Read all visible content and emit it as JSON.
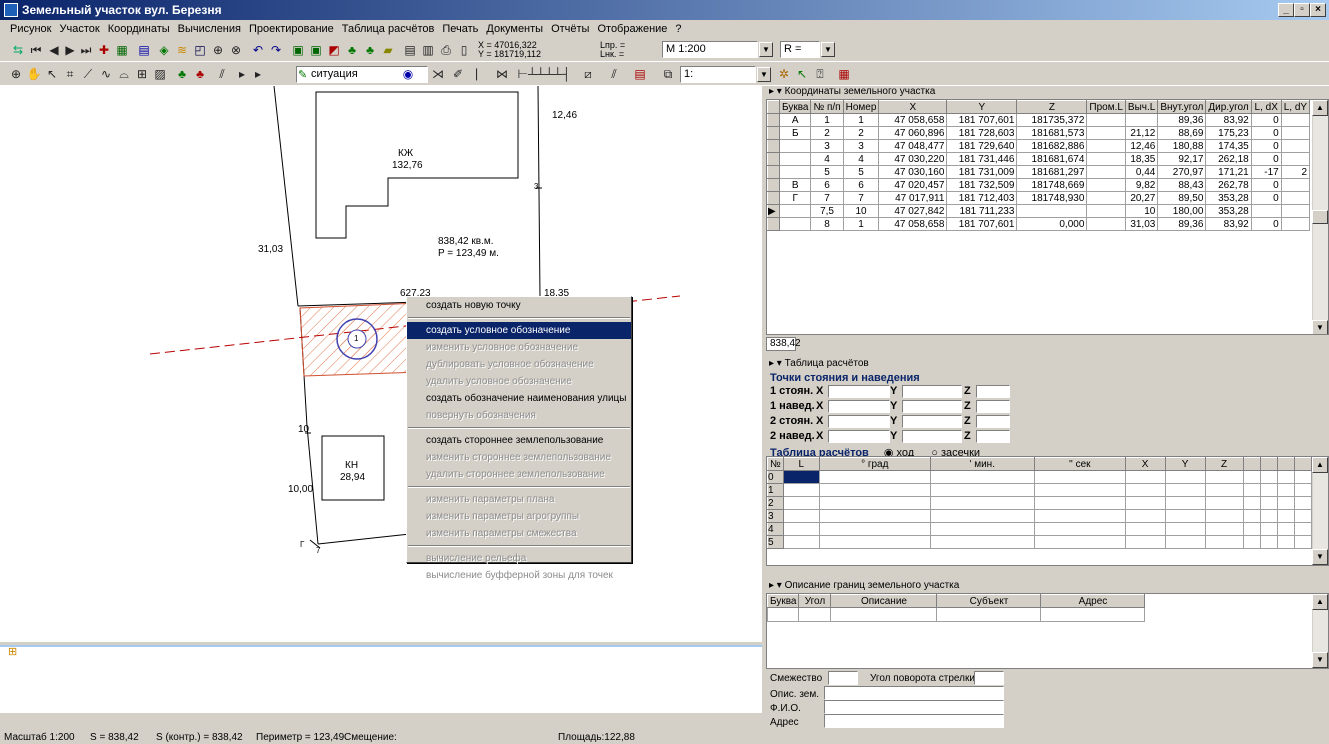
{
  "window": {
    "title": "Земельный участок    вул. Березня",
    "min": "_",
    "max": "▫",
    "close": "×"
  },
  "menu": [
    "Рисунок",
    "Участок",
    "Координаты",
    "Вычисления",
    "Проектирование",
    "Таблица расчётов",
    "Печать",
    "Документы",
    "Отчёты",
    "Отображение",
    "?"
  ],
  "toolbar1": {
    "xy_readout": "X = 47016,322",
    "y_readout": "Y = 181719,112",
    "lpr": "Lпр. =",
    "lnk": "Lнк. =",
    "scale": "М 1:200",
    "r": "R ="
  },
  "toolbar2": {
    "layer": "ситуация",
    "ratio": "1:"
  },
  "drawing": {
    "labels": {
      "kzh": "КЖ",
      "kzh_area": "132,76",
      "area": "838,42 кв.м.",
      "perim": "P = 123,49 м.",
      "kn": "КН",
      "kn_area": "28,94",
      "d1246": "12,46",
      "d3103": "31,03",
      "d1835": "18,35",
      "d62723": "627,23",
      "d10": "10",
      "d1000": "10,00",
      "p3": "3",
      "p7": "7",
      "pg": "Г",
      "p1": "1"
    }
  },
  "context_menu": [
    {
      "label": "создать новую точку",
      "state": "enabled"
    },
    {
      "sep": true
    },
    {
      "label": "создать условное обозначение",
      "state": "selected"
    },
    {
      "label": "изменить условное обозначение",
      "state": "disabled"
    },
    {
      "label": "дублировать условное обозначение",
      "state": "disabled"
    },
    {
      "label": "удалить условное обозначение",
      "state": "disabled"
    },
    {
      "label": "создать обозначение наименования улицы",
      "state": "enabled"
    },
    {
      "label": "повернуть обозначения",
      "state": "disabled"
    },
    {
      "sep": true
    },
    {
      "label": "создать стороннее землепользование",
      "state": "enabled"
    },
    {
      "label": "изменить стороннее землепользование",
      "state": "disabled"
    },
    {
      "label": "удалить стороннее землепользование",
      "state": "disabled"
    },
    {
      "sep": true
    },
    {
      "label": "изменить параметры плана",
      "state": "disabled"
    },
    {
      "label": "изменить параметры агрогруппы",
      "state": "disabled"
    },
    {
      "label": "изменить параметры смежества",
      "state": "disabled"
    },
    {
      "sep": true
    },
    {
      "label": "вычисление рельефа",
      "state": "disabled"
    },
    {
      "label": "вычисление буфферной зоны для точек",
      "state": "disabled"
    }
  ],
  "coords_panel": {
    "title": "Координаты земельного участка",
    "columns": [
      "",
      "Буква",
      "№ п/п",
      "Номер",
      "X",
      "Y",
      "Z",
      "Пром.L",
      "Выч.L",
      "Внут.угол",
      "Дир.угол",
      "L, dX",
      "L, dY"
    ],
    "rows": [
      [
        "",
        "А",
        "1",
        "1",
        "47 058,658",
        "181 707,601",
        "181735,372",
        "",
        "",
        "89,36",
        "83,92",
        "0",
        ""
      ],
      [
        "",
        "Б",
        "2",
        "2",
        "47 060,896",
        "181 728,603",
        "181681,573",
        "",
        "21,12",
        "88,69",
        "175,23",
        "0",
        ""
      ],
      [
        "",
        "",
        "3",
        "3",
        "47 048,477",
        "181 729,640",
        "181682,886",
        "",
        "12,46",
        "180,88",
        "174,35",
        "0",
        ""
      ],
      [
        "",
        "",
        "4",
        "4",
        "47 030,220",
        "181 731,446",
        "181681,674",
        "",
        "18,35",
        "92,17",
        "262,18",
        "0",
        ""
      ],
      [
        "",
        "",
        "5",
        "5",
        "47 030,160",
        "181 731,009",
        "181681,297",
        "",
        "0,44",
        "270,97",
        "171,21",
        "-17",
        "2"
      ],
      [
        "",
        "В",
        "6",
        "6",
        "47 020,457",
        "181 732,509",
        "181748,669",
        "",
        "9,82",
        "88,43",
        "262,78",
        "0",
        ""
      ],
      [
        "",
        "Г",
        "7",
        "7",
        "47 017,911",
        "181 712,403",
        "181748,930",
        "",
        "20,27",
        "89,50",
        "353,28",
        "0",
        ""
      ],
      [
        "▶",
        "",
        "7,5",
        "10",
        "47 027,842",
        "181 711,233",
        "",
        "",
        "10",
        "180,00",
        "353,28",
        "",
        ""
      ],
      [
        "",
        "",
        "8",
        "1",
        "47 058,658",
        "181 707,601",
        "0,000",
        "",
        "31,03",
        "89,36",
        "83,92",
        "0",
        ""
      ]
    ],
    "tab": "838,42"
  },
  "calc_panel": {
    "title": "Таблица расчётов",
    "stations_title": "Точки стояния и наведения",
    "rows": [
      "1 стоян.",
      "1 навед.",
      "2 стоян.",
      "2 навед."
    ],
    "x": "X",
    "y": "Y",
    "z": "Z",
    "table_title": "Таблица расчётов",
    "radio_hod": "ход",
    "radio_zasechki": "засечки",
    "columns": [
      "№",
      "L",
      "° град",
      "' мин.",
      "'' сек",
      "X",
      "Y",
      "Z"
    ],
    "row_nums": [
      "0",
      "1",
      "2",
      "3",
      "4",
      "5"
    ]
  },
  "desc_panel": {
    "title": "Описание границ земельного участка",
    "columns": [
      "Буква",
      "Угол",
      "Описание",
      "Субъект",
      "Адрес"
    ],
    "smezh": "Смежество",
    "angle": "Угол поворота стрелки",
    "opis": "Опис. зем.",
    "fio": "Ф.И.О.",
    "addr": "Адрес"
  },
  "status": {
    "scale": "Масштаб 1:200",
    "s": "S = 838,42",
    "sk": "S (контр.) = 838,42",
    "p": "Периметр = 123,49",
    "sm": "Смещение:",
    "pl": "Площадь:122,88"
  }
}
